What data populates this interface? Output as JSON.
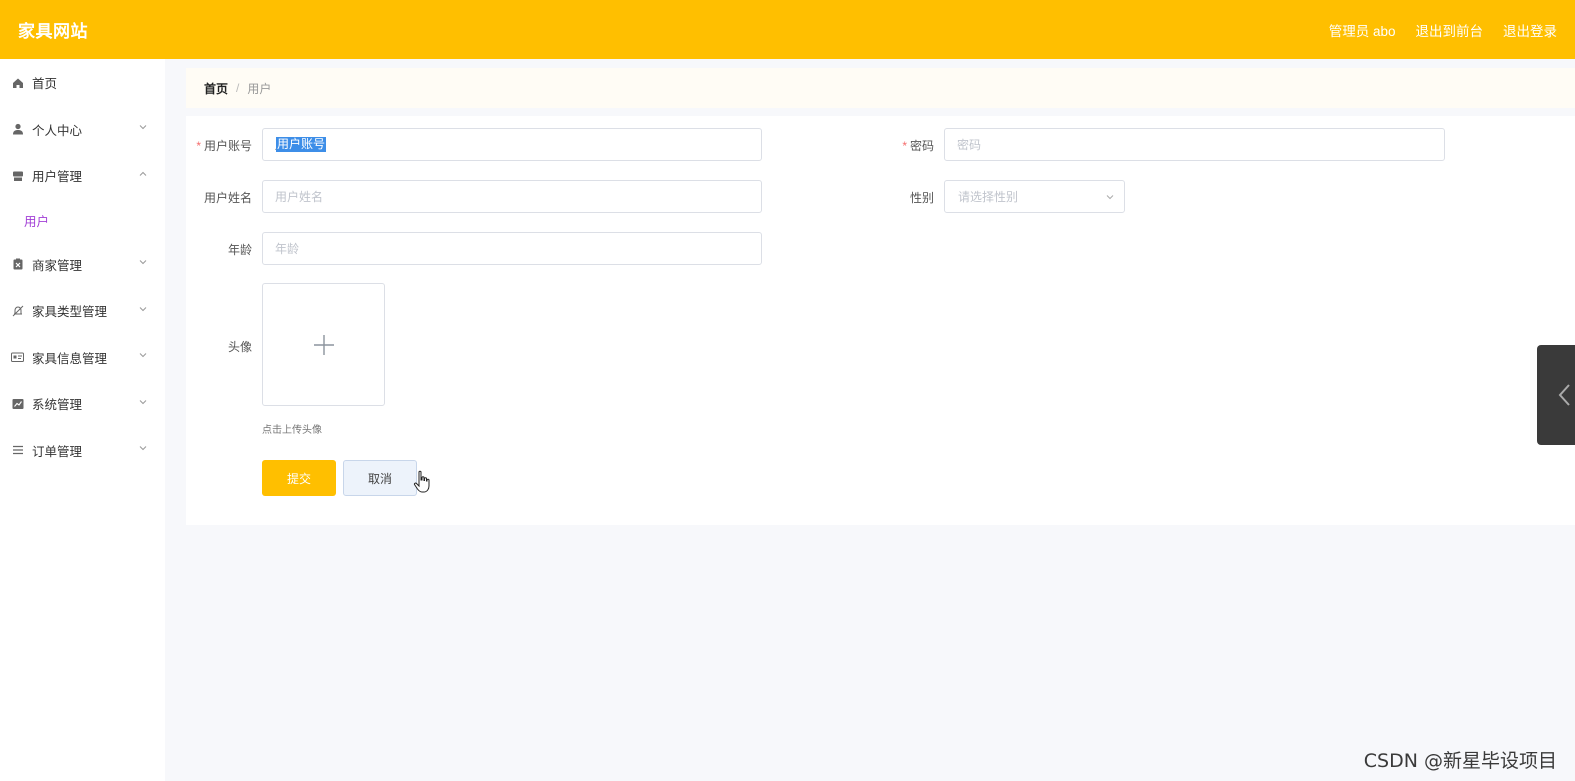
{
  "header": {
    "brand": "家具网站",
    "admin_label": "管理员 abo",
    "back_to_front": "退出到前台",
    "logout": "退出登录"
  },
  "sidebar": {
    "items": [
      {
        "label": "首页",
        "icon": "home-icon"
      },
      {
        "label": "个人中心",
        "icon": "user-icon"
      },
      {
        "label": "用户管理",
        "icon": "store-icon",
        "expanded": true,
        "children": [
          {
            "label": "用户",
            "active": true
          }
        ]
      },
      {
        "label": "商家管理",
        "icon": "clipboard-icon"
      },
      {
        "label": "家具类型管理",
        "icon": "bell-off-icon"
      },
      {
        "label": "家具信息管理",
        "icon": "card-icon"
      },
      {
        "label": "系统管理",
        "icon": "chart-icon"
      },
      {
        "label": "订单管理",
        "icon": "list-icon"
      }
    ]
  },
  "breadcrumb": {
    "home": "首页",
    "sep": "/",
    "current": "用户"
  },
  "form": {
    "account": {
      "label": "用户账号",
      "value": "用户账号",
      "required": true
    },
    "password": {
      "label": "密码",
      "placeholder": "密码",
      "required": true
    },
    "name": {
      "label": "用户姓名",
      "placeholder": "用户姓名"
    },
    "gender": {
      "label": "性别",
      "placeholder": "请选择性别"
    },
    "age": {
      "label": "年龄",
      "placeholder": "年龄"
    },
    "avatar": {
      "label": "头像",
      "hint": "点击上传头像"
    },
    "submit": "提交",
    "cancel": "取消"
  },
  "colors": {
    "accent": "#ffbf00",
    "active_submenu": "#a23fd6",
    "required": "#f56c6c"
  },
  "watermark": "CSDN @新星毕设项目"
}
